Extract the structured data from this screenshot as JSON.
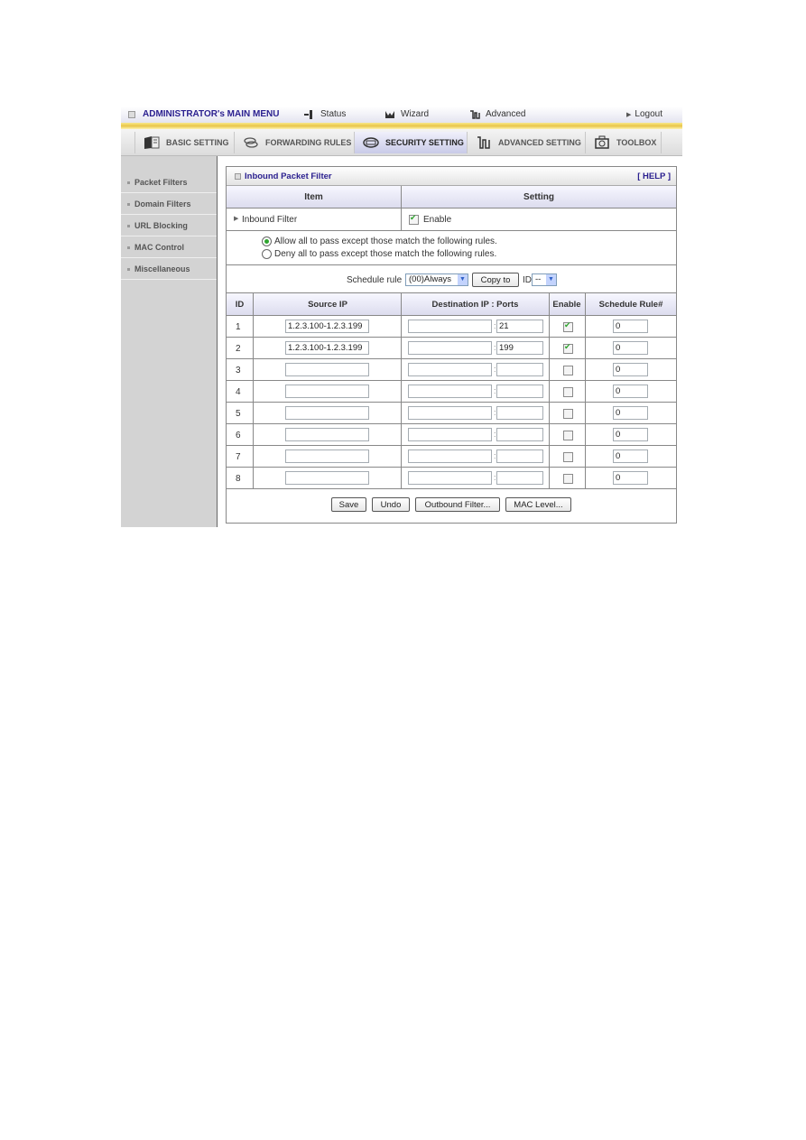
{
  "topbar": {
    "title": "ADMINISTRATOR's MAIN MENU",
    "links": [
      {
        "label": "Status",
        "icon": "status-icon"
      },
      {
        "label": "Wizard",
        "icon": "wizard-icon"
      },
      {
        "label": "Advanced",
        "icon": "advanced-icon"
      },
      {
        "label": "Logout",
        "icon": "arrow-right-icon"
      }
    ]
  },
  "tabs": [
    {
      "label": "BASIC SETTING",
      "icon": "folder-icon",
      "active": false
    },
    {
      "label": "FORWARDING RULES",
      "icon": "forwarding-icon",
      "active": false
    },
    {
      "label": "SECURITY SETTING",
      "icon": "security-icon",
      "active": true
    },
    {
      "label": "ADVANCED SETTING",
      "icon": "advanced-setting-icon",
      "active": false
    },
    {
      "label": "TOOLBOX",
      "icon": "toolbox-icon",
      "active": false
    }
  ],
  "sidebar": {
    "items": [
      {
        "label": "Packet Filters"
      },
      {
        "label": "Domain Filters"
      },
      {
        "label": "URL Blocking"
      },
      {
        "label": "MAC Control"
      },
      {
        "label": "Miscellaneous"
      }
    ]
  },
  "panel": {
    "title": "Inbound Packet Filter",
    "help": "[ HELP ]",
    "header_item": "Item",
    "header_setting": "Setting",
    "inbound_filter_label": "Inbound Filter",
    "enable_label": "Enable",
    "enable_checked": true,
    "radio_allow": "Allow all to pass except those match the following rules.",
    "radio_deny": "Deny all to pass except those match the following rules.",
    "radio_selected": "allow",
    "schedule_rule_label": "Schedule rule",
    "schedule_rule_value": "(00)Always",
    "copy_to_label": "Copy to",
    "id_label": "ID",
    "id_value": "--"
  },
  "table": {
    "columns": [
      "ID",
      "Source IP",
      "Destination IP : Ports",
      "Enable",
      "Schedule Rule#"
    ],
    "rows": [
      {
        "id": "1",
        "source_ip": "1.2.3.100-1.2.3.199",
        "dest_ip": "",
        "port": "21",
        "enabled": true,
        "schedule": "0"
      },
      {
        "id": "2",
        "source_ip": "1.2.3.100-1.2.3.199",
        "dest_ip": "",
        "port": "199",
        "enabled": true,
        "schedule": "0"
      },
      {
        "id": "3",
        "source_ip": "",
        "dest_ip": "",
        "port": "",
        "enabled": false,
        "schedule": "0"
      },
      {
        "id": "4",
        "source_ip": "",
        "dest_ip": "",
        "port": "",
        "enabled": false,
        "schedule": "0"
      },
      {
        "id": "5",
        "source_ip": "",
        "dest_ip": "",
        "port": "",
        "enabled": false,
        "schedule": "0"
      },
      {
        "id": "6",
        "source_ip": "",
        "dest_ip": "",
        "port": "",
        "enabled": false,
        "schedule": "0"
      },
      {
        "id": "7",
        "source_ip": "",
        "dest_ip": "",
        "port": "",
        "enabled": false,
        "schedule": "0"
      },
      {
        "id": "8",
        "source_ip": "",
        "dest_ip": "",
        "port": "",
        "enabled": false,
        "schedule": "0"
      }
    ]
  },
  "buttons": {
    "save": "Save",
    "undo": "Undo",
    "outbound": "Outbound Filter...",
    "mac_level": "MAC Level..."
  }
}
